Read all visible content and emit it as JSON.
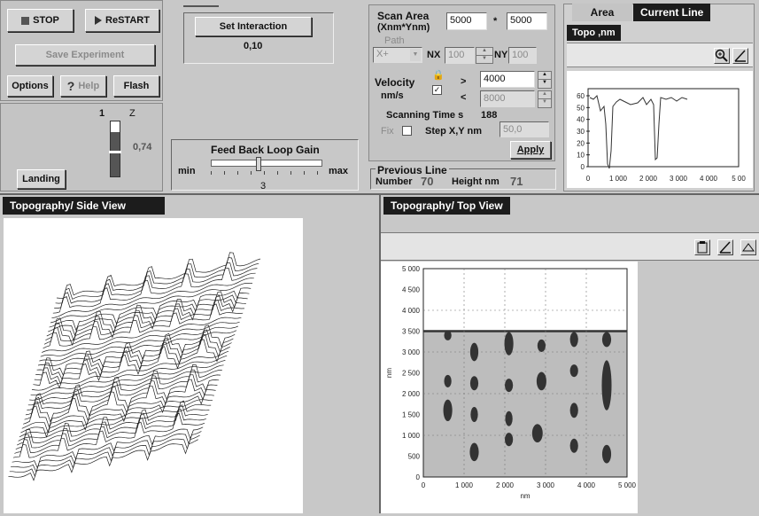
{
  "controls": {
    "stop": "STOP",
    "restart": "ReSTART",
    "save_experiment": "Save Experiment",
    "options": "Options",
    "help": "Help",
    "flash": "Flash",
    "landing": "Landing"
  },
  "z_gauge": {
    "left_label": "1",
    "right_label": "Z",
    "value": "0,74"
  },
  "interaction": {
    "button": "Set Interaction",
    "value": "0,10"
  },
  "feedback": {
    "title": "Feed Back Loop Gain",
    "min": "min",
    "max": "max",
    "value": "3"
  },
  "scan": {
    "area_label": "Scan Area",
    "area_sub": "(Xnm*Ynm)",
    "area_x": "5000",
    "times": "*",
    "area_y": "5000",
    "path_label": "Path",
    "path_value": "X+",
    "nx_label": "NX",
    "nx_value": "100",
    "ny_label": "NY",
    "ny_value": "100",
    "velocity_label": "Velocity",
    "velocity_unit": "nm/s",
    "gt": ">",
    "lt": "<",
    "velocity_fwd": "4000",
    "velocity_back": "8000",
    "scanning_time_label": "Scanning Time s",
    "scanning_time": "188",
    "fix_label": "Fix",
    "step_label": "Step X,Y  nm",
    "step_value": "50,0",
    "apply": "Apply"
  },
  "previous_line": {
    "title": "Previous  Line",
    "number_label": "Number",
    "number": "70",
    "height_label": "Height nm",
    "height": "71"
  },
  "right_tabs": {
    "area": "Area",
    "current_line": "Current Line",
    "topo": "Topo ,nm"
  },
  "line_plot": {
    "y_ticks": [
      "60",
      "50",
      "40",
      "30",
      "20",
      "10",
      "0"
    ],
    "x_ticks": [
      "0",
      "1 000",
      "2 000",
      "3 000",
      "4 000",
      "5 00"
    ]
  },
  "side_view": {
    "title": "Topography/ Side View"
  },
  "top_view": {
    "title": "Topography/ Top View",
    "y_ticks": [
      "5 000",
      "4 500",
      "4 000",
      "3 500",
      "3 000",
      "2 500",
      "2 000",
      "1 500",
      "1 000",
      "500",
      "0"
    ],
    "x_ticks": [
      "0",
      "1 000",
      "2 000",
      "3 000",
      "4 000",
      "5 000"
    ],
    "xlabel": "nm",
    "ylabel": "nm"
  },
  "icons": [
    "zoom-in-icon",
    "line-tool-icon",
    "clipboard-icon",
    "angle-icon",
    "tilt-icon"
  ]
}
